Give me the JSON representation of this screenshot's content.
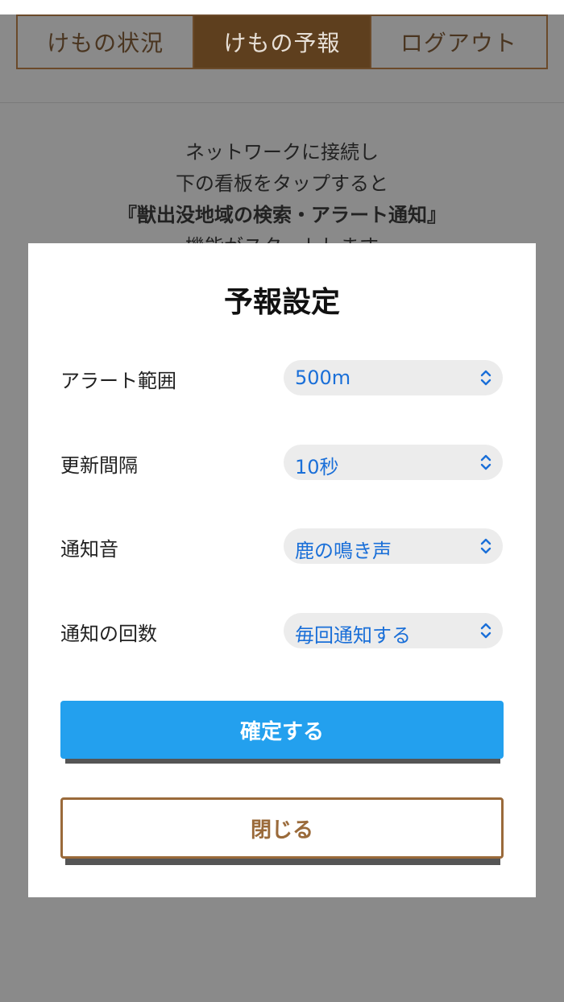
{
  "tabs": [
    {
      "label": "けもの状況",
      "active": false
    },
    {
      "label": "けもの予報",
      "active": true
    },
    {
      "label": "ログアウト",
      "active": false
    }
  ],
  "background_text": {
    "line1": "ネットワークに接続し",
    "line2": "下の看板をタップすると",
    "line3": "『獣出没地域の検索・アラート通知』",
    "line4": "機能がスタートします"
  },
  "modal": {
    "title": "予報設定",
    "settings": [
      {
        "label": "アラート範囲",
        "value": "500m"
      },
      {
        "label": "更新間隔",
        "value": "10秒"
      },
      {
        "label": "通知音",
        "value": "鹿の鳴き声"
      },
      {
        "label": "通知の回数",
        "value": "毎回通知する"
      }
    ],
    "confirm_label": "確定する",
    "close_label": "閉じる"
  },
  "colors": {
    "active_tab": "#5e3f1e",
    "confirm_button": "#23a0ee",
    "close_button_border": "#9a6a3a",
    "select_text": "#1a6fd8"
  },
  "icons": {
    "select_chevron": "chevron-up-down-icon"
  }
}
